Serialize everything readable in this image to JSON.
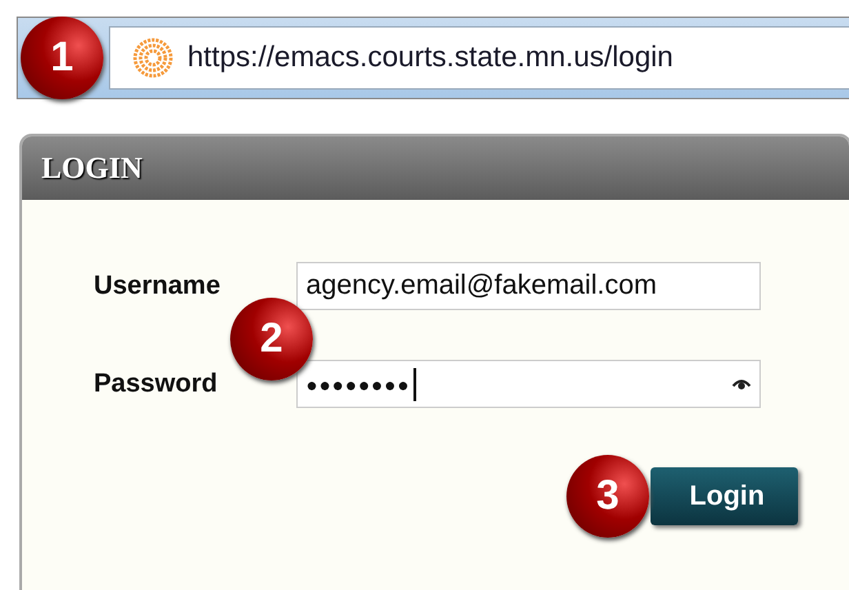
{
  "address_bar": {
    "url": "https://emacs.courts.state.mn.us/login"
  },
  "panel": {
    "title": "LOGIN"
  },
  "fields": [
    {
      "label": "Username",
      "value": "agency.email@fakemail.com",
      "kind": "text"
    },
    {
      "label": "Password",
      "value": "●●●●●●●●",
      "kind": "password"
    }
  ],
  "login_button": {
    "label": "Login"
  },
  "step_badges": [
    "1",
    "2",
    "3"
  ]
}
